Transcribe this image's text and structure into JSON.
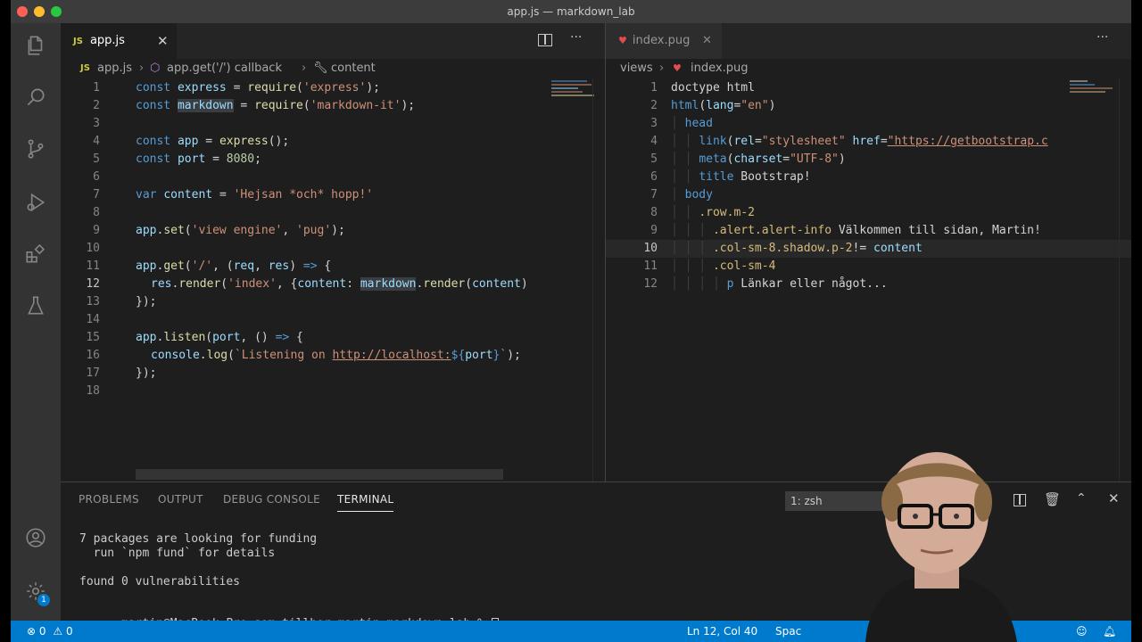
{
  "window": {
    "title": "app.js — markdown_lab"
  },
  "activity_bar": {
    "icons": [
      "files-icon",
      "search-icon",
      "source-control-icon",
      "run-debug-icon",
      "extensions-icon",
      "testing-icon",
      "account-icon",
      "manage-gear-icon"
    ],
    "manage_badge": "1"
  },
  "left_editor": {
    "tab": {
      "icon_label": "JS",
      "label": "app.js"
    },
    "breadcrumbs": {
      "icon_label": "JS",
      "file": "app.js",
      "symbol1": "app.get('/') callback",
      "symbol2": "content"
    },
    "lines": [
      {
        "n": "1",
        "text": "const express = require('express');"
      },
      {
        "n": "2",
        "text": "const markdown = require('markdown-it');"
      },
      {
        "n": "3",
        "text": ""
      },
      {
        "n": "4",
        "text": "const app = express();"
      },
      {
        "n": "5",
        "text": "const port = 8080;"
      },
      {
        "n": "6",
        "text": ""
      },
      {
        "n": "7",
        "text": "var content = 'Hejsan *och* hopp!'"
      },
      {
        "n": "8",
        "text": ""
      },
      {
        "n": "9",
        "text": "app.set('view engine', 'pug');"
      },
      {
        "n": "10",
        "text": ""
      },
      {
        "n": "11",
        "text": "app.get('/', (req, res) => {"
      },
      {
        "n": "12",
        "text": "  res.render('index', {content: markdown.render(content)"
      },
      {
        "n": "13",
        "text": "});"
      },
      {
        "n": "14",
        "text": ""
      },
      {
        "n": "15",
        "text": "app.listen(port, () => {"
      },
      {
        "n": "16",
        "text": "  console.log(`Listening on http://localhost:${port}`);"
      },
      {
        "n": "17",
        "text": "});"
      },
      {
        "n": "18",
        "text": ""
      }
    ],
    "current_line": "12"
  },
  "right_editor": {
    "tab": {
      "label": "index.pug"
    },
    "breadcrumbs": {
      "folder": "views",
      "file": "index.pug"
    },
    "lines": [
      {
        "n": "1",
        "text": "doctype html"
      },
      {
        "n": "2",
        "text": "html(lang=\"en\")"
      },
      {
        "n": "3",
        "text": "  head"
      },
      {
        "n": "4",
        "text": "    link(rel=\"stylesheet\" href=\"https://getbootstrap.c"
      },
      {
        "n": "5",
        "text": "    meta(charset=\"UTF-8\")"
      },
      {
        "n": "6",
        "text": "    title Bootstrap!"
      },
      {
        "n": "7",
        "text": "  body"
      },
      {
        "n": "8",
        "text": "    .row.m-2"
      },
      {
        "n": "9",
        "text": "      .alert.alert-info Välkommen till sidan, Martin!"
      },
      {
        "n": "10",
        "text": "      .col-sm-8.shadow.p-2!= content"
      },
      {
        "n": "11",
        "text": "      .col-sm-4"
      },
      {
        "n": "12",
        "text": "        p Länkar eller något..."
      }
    ],
    "current_line": "10"
  },
  "panel": {
    "tabs": [
      "PROBLEMS",
      "OUTPUT",
      "DEBUG CONSOLE",
      "TERMINAL"
    ],
    "active_tab": "TERMINAL",
    "terminal_select": "1: zsh",
    "terminal_lines": [
      "7 packages are looking for funding",
      "  run `npm fund` for details",
      "",
      "found 0 vulnerabilities",
      "",
      "martin@MacBook-Pro-som-tillhor-martin markdown_lab % "
    ]
  },
  "status_bar": {
    "errors": "0",
    "warnings": "0",
    "cursor_position": "Ln 12, Col 40",
    "indentation": "Spac"
  },
  "colors": {
    "status_bar": "#007acc",
    "editor_bg": "#1e1e1e",
    "activity_bar": "#333333",
    "title_bar": "#3c3c3c"
  }
}
